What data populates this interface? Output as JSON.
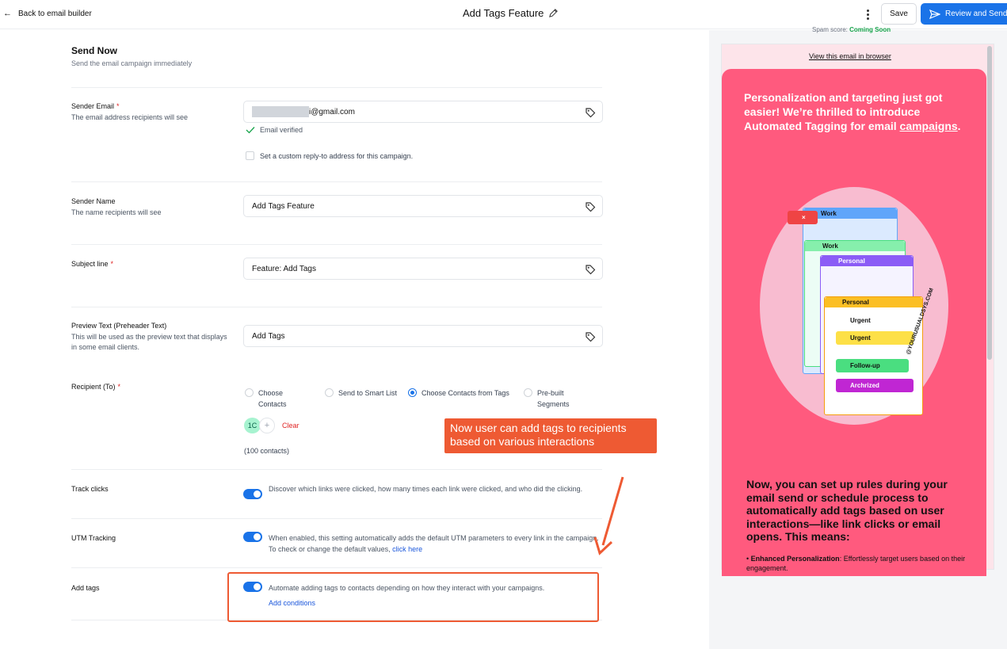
{
  "topbar": {
    "back_label": "Back to email builder",
    "title": "Add Tags Feature",
    "save_label": "Save",
    "review_label": "Review and Send"
  },
  "section": {
    "title": "Send Now",
    "subtitle": "Send the email campaign immediately"
  },
  "sender_email": {
    "label": "Sender Email",
    "required": "*",
    "desc": "The email address recipients will see",
    "value_suffix": "i@gmail.com",
    "verified": "Email verified",
    "custom_reply": "Set a custom reply-to address for this campaign."
  },
  "sender_name": {
    "label": "Sender Name",
    "desc": "The name recipients will see",
    "value": "Add Tags Feature"
  },
  "subject": {
    "label": "Subject line",
    "required": "*",
    "value": "Feature: Add Tags"
  },
  "preview_text": {
    "label": "Preview Text (Preheader Text)",
    "desc": "This will be used as the preview text that displays in some email clients.",
    "value": "Add Tags"
  },
  "recipient": {
    "label": "Recipient (To)",
    "required": "*",
    "options": [
      "Choose Contacts",
      "Send to Smart List",
      "Choose Contacts from Tags",
      "Pre-built Segments"
    ],
    "selected": "Choose Contacts from Tags",
    "chip": "1C",
    "clear": "Clear",
    "count": "(100 contacts)"
  },
  "track_clicks": {
    "label": "Track clicks",
    "desc": "Discover which links were clicked, how many times each link were clicked, and who did the clicking."
  },
  "utm": {
    "label": "UTM Tracking",
    "desc": "When enabled, this setting automatically adds the default UTM parameters to every link in the campaign. To check or change the default values,",
    "link": "click here"
  },
  "add_tags": {
    "label": "Add tags",
    "desc": "Automate adding tags to contacts depending on how they interact with your campaigns.",
    "link": "Add conditions"
  },
  "callout": "Now user can add tags to recipients based on various interactions",
  "preview": {
    "spam_label": "Spam score:",
    "spam_value": "Coming Soon",
    "view_link": "View this email in browser",
    "heading_part1": "Personalization and targeting just got easier! We’re thrilled to introduce Automated Tagging for email ",
    "heading_link": "campaigns",
    "heading_end": ".",
    "body": "Now, you can set up rules during your email send or schedule process to automatically add tags based on user interactions—like link clicks or email opens. This means:",
    "bullet_bold": "Enhanced Personalization",
    "bullet_text": ": Effortlessly target users based on their engagement.",
    "illustration_tags": [
      "Work",
      "Work",
      "Personal",
      "Personal",
      "Urgent",
      "Urgent",
      "Follow-up",
      "Archrized"
    ],
    "watermark": "@YOURUSUALDSYS.COM"
  },
  "colors": {
    "accent": "#1a73e8",
    "callout": "#ee5a33",
    "email_bg": "#ff5a7e"
  }
}
